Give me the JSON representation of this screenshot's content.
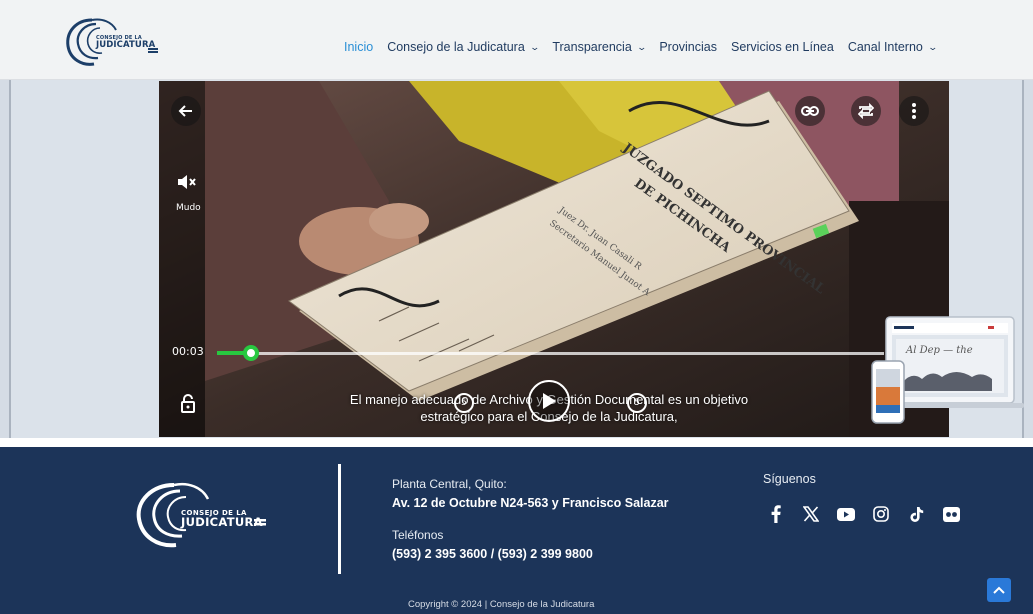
{
  "header": {
    "logo": {
      "line1": "CONSEJO DE LA",
      "line2": "JUDICATURA"
    },
    "nav": [
      {
        "label": "Inicio",
        "active": true,
        "dropdown": false
      },
      {
        "label": "Consejo de la Judicatura",
        "active": false,
        "dropdown": true
      },
      {
        "label": "Transparencia",
        "active": false,
        "dropdown": true
      },
      {
        "label": "Provincias",
        "active": false,
        "dropdown": false
      },
      {
        "label": "Servicios en Línea",
        "active": false,
        "dropdown": false
      },
      {
        "label": "Canal Interno",
        "active": false,
        "dropdown": true
      }
    ]
  },
  "video": {
    "mute_label": "Mudo",
    "current_time": "00:03",
    "progress_percent": 5,
    "caption_line1": "El manejo adecuado de Archivo y Gestión Documental es un objetivo",
    "caption_line2": "estratégico para el Consejo de la Judicatura,",
    "skip_back": "5",
    "skip_forward": "5",
    "icons": [
      "back-arrow-icon",
      "mute-icon",
      "link-icon",
      "repeat-icon",
      "more-vertical-icon",
      "lock-icon",
      "play-icon"
    ]
  },
  "footer": {
    "logo": {
      "line1": "CONSEJO DE LA",
      "line2": "JUDICATURA"
    },
    "address_label": "Planta Central, Quito:",
    "address": "Av. 12 de Octubre N24-563 y Francisco Salazar",
    "phones_label": "Teléfonos",
    "phones": "(593) 2 395 3600 / (593) 2 399 9800",
    "follow_label": "Síguenos",
    "socials": [
      "facebook-icon",
      "x-twitter-icon",
      "youtube-icon",
      "instagram-icon",
      "tiktok-icon",
      "flickr-icon"
    ],
    "copyright": "Copyright © 2024 | Consejo de la Judicatura"
  },
  "colors": {
    "navy": "#1c3459",
    "nav_active": "#2a8fd6",
    "progress": "#28c840",
    "to_top": "#2a79d8"
  }
}
